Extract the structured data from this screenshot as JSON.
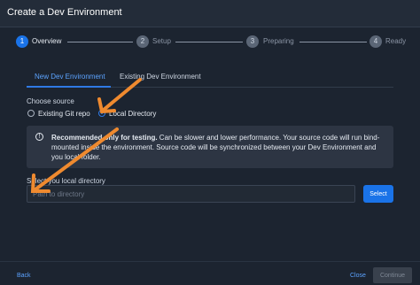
{
  "window": {
    "title": "Create a Dev Environment"
  },
  "stepper": {
    "steps": [
      {
        "number": "1",
        "label": "Overview",
        "active": true
      },
      {
        "number": "2",
        "label": "Setup",
        "active": false
      },
      {
        "number": "3",
        "label": "Preparing",
        "active": false
      },
      {
        "number": "4",
        "label": "Ready",
        "active": false
      }
    ]
  },
  "tabs": [
    {
      "label": "New Dev Environment",
      "active": true
    },
    {
      "label": "Existing Dev Environment",
      "active": false
    }
  ],
  "source": {
    "label": "Choose source",
    "options": [
      {
        "label": "Existing Git repo",
        "checked": false
      },
      {
        "label": "Local Directory",
        "checked": true
      }
    ]
  },
  "alert": {
    "strong": "Recommended only for testing.",
    "text": " Can be slower and lower performance. Your source code will run bind-mounted inside the environment. Source code will be synchronized between your Dev Environment and you local folder."
  },
  "directory": {
    "label": "Select you local directory",
    "placeholder": "Path to directory",
    "button": "Select"
  },
  "footer": {
    "back": "Back",
    "close": "Close",
    "continue": "Continue"
  },
  "colors": {
    "accent": "#1a73e8",
    "background": "#1c2430",
    "annotation_arrow": "#ef8a2f"
  }
}
